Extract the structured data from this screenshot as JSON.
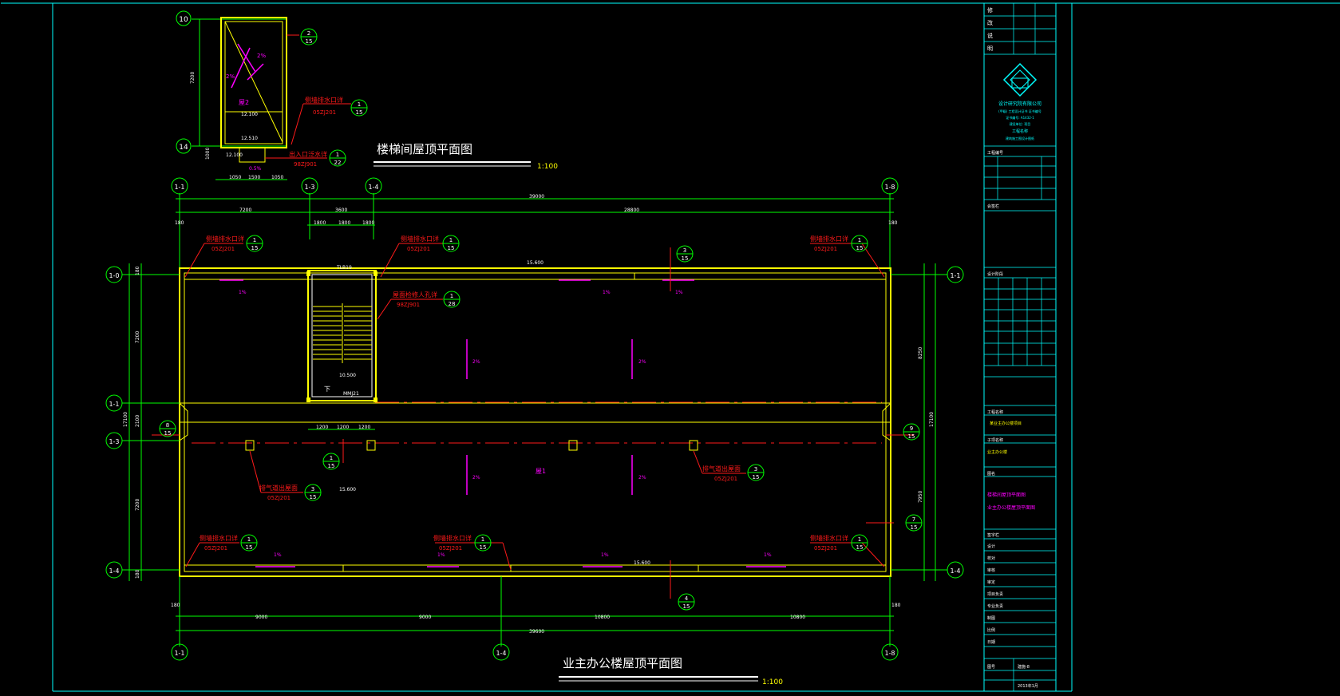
{
  "stair_roof": {
    "title": "楼梯间屋顶平面图",
    "scale": "1:100",
    "dims": {
      "height": "7200",
      "bottom_ext": "1000",
      "w1": "1050",
      "w2": "1500",
      "w3": "1050"
    },
    "level_top": "12.100",
    "level_mid": "12.510",
    "level_bottom": "12.100",
    "room_label": "屋2",
    "slope_a": "2%",
    "slope_b": "2%",
    "slope_c": "0.5%",
    "axis_top": "10",
    "axis_bottom": "14",
    "callouts": [
      {
        "text": "侧墙排水口详",
        "ref": "05ZJ201",
        "num": "1",
        "den": "15"
      },
      {
        "text": "出入口泛水详",
        "ref": "98ZJ901",
        "num": "1",
        "den": "22"
      }
    ],
    "bubble_top": {
      "num": "2",
      "den": "15"
    }
  },
  "main_roof": {
    "title": "业主办公楼屋顶平面图",
    "scale": "1:100",
    "axes_top": [
      "1-1",
      "1-3",
      "1-4",
      "1-8"
    ],
    "axes_bottom": [
      "1-1",
      "1-4",
      "1-8"
    ],
    "axes_left": [
      "1-0",
      "1-1",
      "1-3",
      "1-4"
    ],
    "axes_right": [
      "1-1",
      "1-4"
    ],
    "dims_top_total": "39000",
    "dims_top_parts": [
      "7200",
      "3600",
      "28800"
    ],
    "dims_top_small": [
      "1800",
      "1800",
      "1800"
    ],
    "dims_top_edge": [
      "180",
      "180"
    ],
    "dims_bottom_parts": [
      "9000",
      "9000",
      "10800",
      "10800"
    ],
    "dims_bottom_total": "39600",
    "dims_bottom_edge": [
      "180",
      "180"
    ],
    "dims_left": [
      "7200",
      "2100",
      "7200"
    ],
    "dims_left_edge": [
      "180",
      "180"
    ],
    "dims_left_total": "17100",
    "dims_right": [
      "8250",
      "7950"
    ],
    "dims_right_total": "17100",
    "dims_mid": [
      "1200",
      "1200",
      "1200"
    ],
    "slopes": [
      "1%",
      "1%",
      "1%",
      "2%",
      "2%",
      "2%",
      "2%",
      "1%",
      "1%",
      "1%",
      "1%"
    ],
    "levels": [
      "15.600",
      "15.600",
      "15.600",
      "10.500"
    ],
    "room_label": "屋1",
    "stair_labels": [
      "TLB19",
      "MMJ21",
      "下"
    ],
    "drain_callouts": [
      {
        "text": "侧墙排水口详",
        "ref": "05ZJ201",
        "num": "1",
        "den": "15"
      },
      {
        "text": "侧墙排水口详",
        "ref": "05ZJ201",
        "num": "1",
        "den": "15"
      },
      {
        "text": "侧墙排水口详",
        "ref": "05ZJ201",
        "num": "1",
        "den": "15"
      },
      {
        "text": "侧墙排水口详",
        "ref": "05ZJ201",
        "num": "1",
        "den": "15"
      },
      {
        "text": "侧墙排水口详",
        "ref": "05ZJ201",
        "num": "1",
        "den": "15"
      },
      {
        "text": "侧墙排水口详",
        "ref": "05ZJ201",
        "num": "1",
        "den": "15"
      }
    ],
    "vent_callouts": [
      {
        "text": "排气道出屋面",
        "ref": "05ZJ201",
        "num": "3",
        "den": "15"
      },
      {
        "text": "排气道出屋面",
        "ref": "05ZJ201",
        "num": "3",
        "den": "15"
      }
    ],
    "ladder_callout": {
      "text": "屋面检修人孔详",
      "ref": "98ZJ901",
      "num": "1",
      "den": "28"
    },
    "section_marks": [
      {
        "num": "3",
        "den": "15"
      },
      {
        "num": "4",
        "den": "15"
      },
      {
        "num": "7",
        "den": "15"
      },
      {
        "num": "8",
        "den": "15"
      },
      {
        "num": "9",
        "den": "15"
      },
      {
        "num": "1",
        "den": "15"
      }
    ]
  },
  "title_block": {
    "rows_top": [
      "修",
      "改",
      "说",
      "明"
    ],
    "company": "设计研究院有限公司",
    "company_lines": [
      "(甲级) 工程设计证书 证书编号",
      "证书编号: A1432-1",
      "建设单位: 项目",
      "工程名称",
      "建筑施工图设计图纸"
    ],
    "section_labels": [
      "工程编号",
      "设计阶段",
      "会签栏",
      "工程名称",
      "子项名称",
      "图名",
      "签字栏"
    ],
    "project_name": "某业主办公楼项目",
    "sub_name": "业主办公楼",
    "drawing_names": [
      "楼梯间屋顶平面图",
      "业主办公楼屋顶平面图"
    ],
    "roles": [
      "设计",
      "校对",
      "审核",
      "审定",
      "项目负责",
      "专业负责",
      "制图",
      "比例",
      "日期",
      "图号"
    ],
    "date": "2013年1月",
    "sheet": "建施-8"
  },
  "colors": {
    "background": "#000000",
    "frame": "#00ffff",
    "axis": "#00ff00",
    "wall": "#ffff00",
    "annotation_red": "#ff1a1a",
    "slope_magenta": "#ff00ff",
    "white": "#ffffff"
  }
}
